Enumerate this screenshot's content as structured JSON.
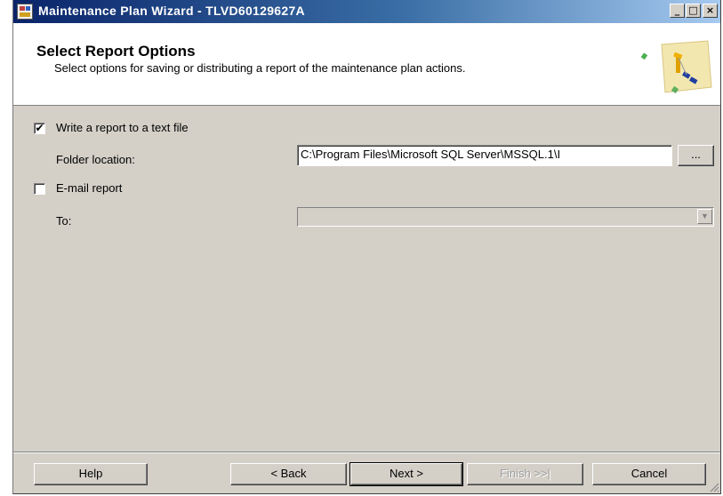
{
  "window": {
    "title": "Maintenance Plan Wizard - TLVD60129627A",
    "controls": {
      "minimize": "_",
      "maximize": "□",
      "close": "×"
    }
  },
  "header": {
    "title": "Select Report Options",
    "subtitle": "Select options for saving or distributing a report of the maintenance plan actions."
  },
  "options": {
    "write_report": {
      "label": "Write a report to a text file",
      "checked": true,
      "mark": "✔"
    },
    "folder_location": {
      "label": "Folder location:",
      "value": "C:\\Program Files\\Microsoft SQL Server\\MSSQL.1\\I",
      "browse_label": "..."
    },
    "email_report": {
      "label": "E-mail report",
      "checked": false,
      "mark": ""
    },
    "to": {
      "label": "To:",
      "value": "",
      "arrow": "▼"
    }
  },
  "buttons": {
    "help": "Help",
    "back": "< Back",
    "next": "Next >",
    "finish": "Finish >>|",
    "cancel": "Cancel"
  },
  "colors": {
    "dialog_bg": "#d4d0c8",
    "title_gradient_start": "#0a246a",
    "title_gradient_end": "#a6caf0",
    "disabled_text": "#a0a0a0"
  },
  "icons": {
    "app": "maintenance-plan-icon",
    "header": "wizard-diagram-icon"
  }
}
